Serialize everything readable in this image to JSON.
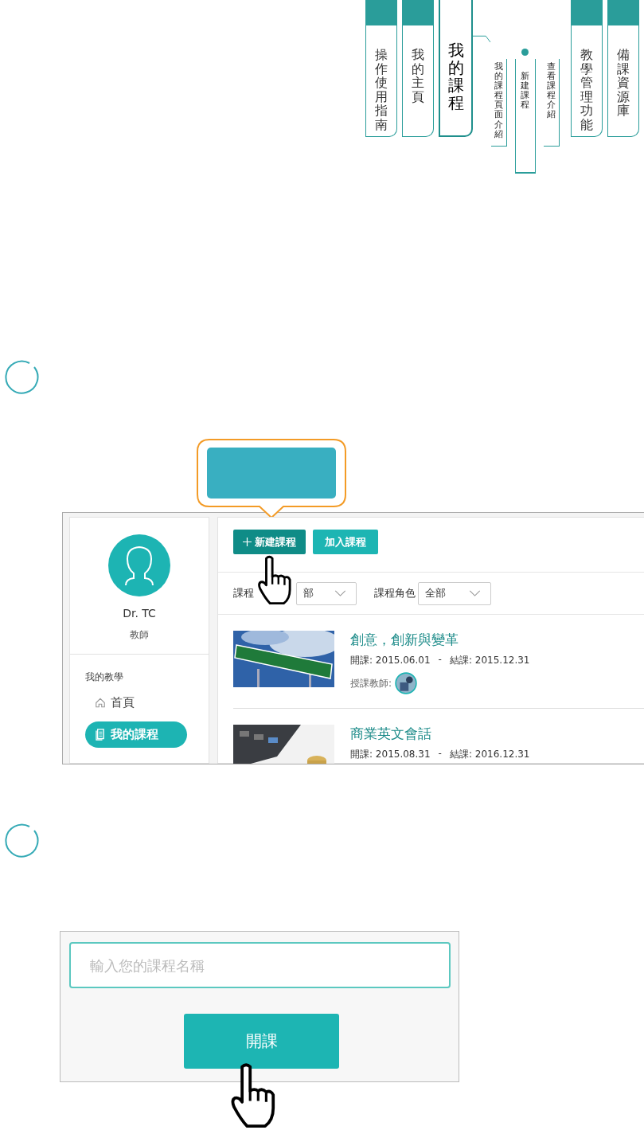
{
  "nav": {
    "tabs": [
      {
        "label": "操作使用指南",
        "selected": false
      },
      {
        "label": "我的主頁",
        "selected": false
      },
      {
        "label": "我的課程",
        "selected": true,
        "children": [
          {
            "label": "我的課程頁面介紹",
            "selected": false
          },
          {
            "label": "新建課程",
            "selected": true
          },
          {
            "label": "查看課程介紹",
            "selected": false
          }
        ]
      },
      {
        "label": "教學管理功能",
        "selected": false
      },
      {
        "label": "備課資源庫",
        "selected": false
      }
    ]
  },
  "screenshot_1": {
    "profile": {
      "name": "Dr. TC",
      "role": "教師"
    },
    "sidebar": {
      "section": "我的教學",
      "items": [
        {
          "label": "首頁",
          "selected": false,
          "kind": "home"
        },
        {
          "label": "我的課程",
          "selected": true,
          "kind": "courses"
        }
      ]
    },
    "buttons": [
      {
        "label": "新建課程",
        "kind": "primary"
      },
      {
        "label": "加入課程",
        "kind": "secondary"
      }
    ],
    "filters": [
      {
        "label": "課程",
        "value": "部"
      },
      {
        "label": "課程角色",
        "value": "全部"
      }
    ],
    "courses": [
      {
        "title": "創意，創新與變革",
        "start": "開課: 2015.06.01",
        "separator": "-",
        "end": "結課: 2015.12.31",
        "teacher_label": "授課教師:"
      },
      {
        "title": "商業英文會話",
        "start": "開課: 2015.08.31",
        "separator": "-",
        "end": "結課: 2016.12.31"
      }
    ]
  },
  "screenshot_2": {
    "field": {
      "placeholder": "輸入您的課程名稱"
    },
    "button": "開課"
  }
}
